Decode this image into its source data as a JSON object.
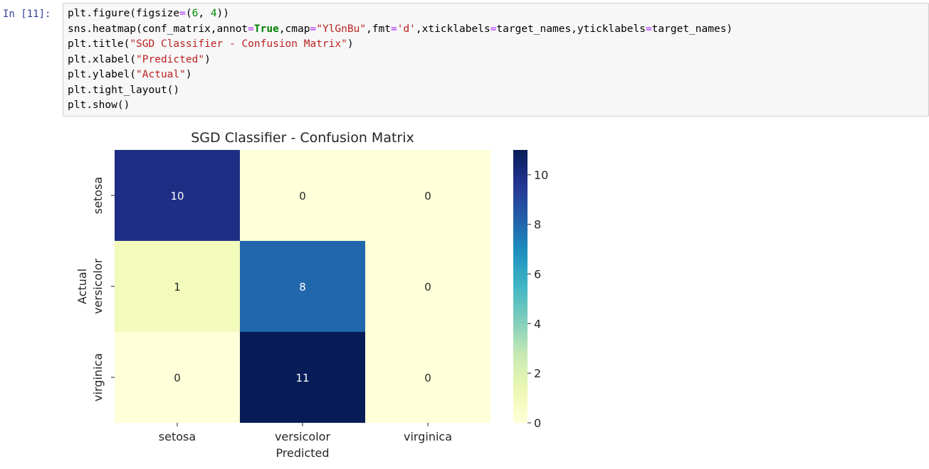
{
  "cell": {
    "prompt": "In [11]:",
    "code_lines": [
      [
        {
          "t": "plt.figure(figsize"
        },
        {
          "t": "=",
          "c": "op"
        },
        {
          "t": "("
        },
        {
          "t": "6",
          "c": "num"
        },
        {
          "t": ", "
        },
        {
          "t": "4",
          "c": "num"
        },
        {
          "t": "))"
        }
      ],
      [
        {
          "t": "sns.heatmap(conf_matrix,annot"
        },
        {
          "t": "=",
          "c": "op"
        },
        {
          "t": "True",
          "c": "kw"
        },
        {
          "t": ",cmap"
        },
        {
          "t": "=",
          "c": "op"
        },
        {
          "t": "\"YlGnBu\"",
          "c": "str"
        },
        {
          "t": ",fmt"
        },
        {
          "t": "=",
          "c": "op"
        },
        {
          "t": "'d'",
          "c": "str"
        },
        {
          "t": ",xticklabels"
        },
        {
          "t": "=",
          "c": "op"
        },
        {
          "t": "target_names,yticklabels"
        },
        {
          "t": "=",
          "c": "op"
        },
        {
          "t": "target_names)"
        }
      ],
      [
        {
          "t": "plt.title("
        },
        {
          "t": "\"SGD Classifier - Confusion Matrix\"",
          "c": "str"
        },
        {
          "t": ")"
        }
      ],
      [
        {
          "t": "plt.xlabel("
        },
        {
          "t": "\"Predicted\"",
          "c": "str"
        },
        {
          "t": ")"
        }
      ],
      [
        {
          "t": "plt.ylabel("
        },
        {
          "t": "\"Actual\"",
          "c": "str"
        },
        {
          "t": ")"
        }
      ],
      [
        {
          "t": "plt.tight_layout()"
        }
      ],
      [
        {
          "t": "plt.show()"
        }
      ]
    ]
  },
  "chart_data": {
    "type": "heatmap",
    "title": "SGD Classifier - Confusion Matrix",
    "xlabel": "Predicted",
    "ylabel": "Actual",
    "x_categories": [
      "setosa",
      "versicolor",
      "virginica"
    ],
    "y_categories": [
      "setosa",
      "versicolor",
      "virginica"
    ],
    "values": [
      [
        10,
        0,
        0
      ],
      [
        1,
        8,
        0
      ],
      [
        0,
        11,
        0
      ]
    ],
    "colormap": "YlGnBu",
    "colorbar": {
      "min": 0,
      "max": 11,
      "ticks": [
        0,
        2,
        4,
        6,
        8,
        10
      ]
    },
    "colors": {
      "annot_dark_text": "#262626",
      "annot_light_text": "#ffffff"
    }
  }
}
